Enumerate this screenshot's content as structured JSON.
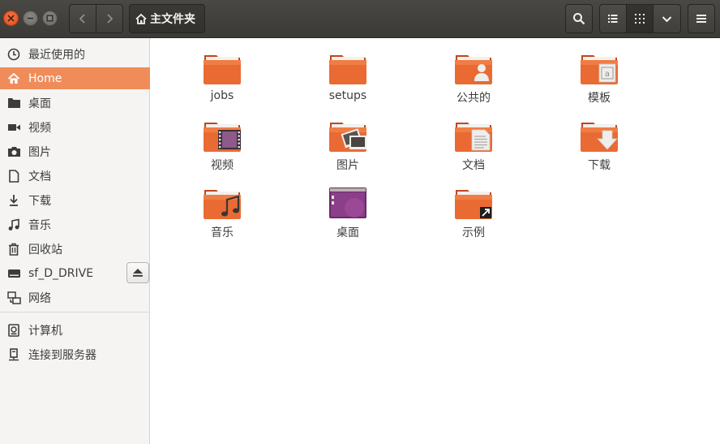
{
  "header": {
    "path_label": "主文件夹",
    "back_icon": "back-arrow-icon",
    "forward_icon": "forward-arrow-icon"
  },
  "sidebar": {
    "items": [
      {
        "label": "最近使用的",
        "icon": "clock-icon"
      },
      {
        "label": "Home",
        "icon": "home-icon",
        "active": true
      },
      {
        "label": "桌面",
        "icon": "folder-icon"
      },
      {
        "label": "视频",
        "icon": "video-icon"
      },
      {
        "label": "图片",
        "icon": "camera-icon"
      },
      {
        "label": "文档",
        "icon": "document-icon"
      },
      {
        "label": "下载",
        "icon": "download-icon"
      },
      {
        "label": "音乐",
        "icon": "music-icon"
      },
      {
        "label": "回收站",
        "icon": "trash-icon"
      },
      {
        "label": "sf_D_DRIVE",
        "icon": "drive-icon"
      },
      {
        "label": "网络",
        "icon": "network-icon"
      },
      {
        "label": "计算机",
        "icon": "computer-icon"
      },
      {
        "label": "连接到服务器",
        "icon": "server-icon"
      }
    ]
  },
  "files": [
    {
      "label": "jobs",
      "emblem": "none"
    },
    {
      "label": "setups",
      "emblem": "none"
    },
    {
      "label": "公共的",
      "emblem": "person"
    },
    {
      "label": "模板",
      "emblem": "template"
    },
    {
      "label": "视频",
      "emblem": "film"
    },
    {
      "label": "图片",
      "emblem": "photo"
    },
    {
      "label": "文档",
      "emblem": "doc"
    },
    {
      "label": "下载",
      "emblem": "download"
    },
    {
      "label": "音乐",
      "emblem": "music"
    },
    {
      "label": "桌面",
      "emblem": "desktop"
    },
    {
      "label": "示例",
      "emblem": "link"
    }
  ],
  "colors": {
    "accent": "#f08c5a",
    "folder": "#e95c25",
    "headerbar": "#403f3b"
  }
}
